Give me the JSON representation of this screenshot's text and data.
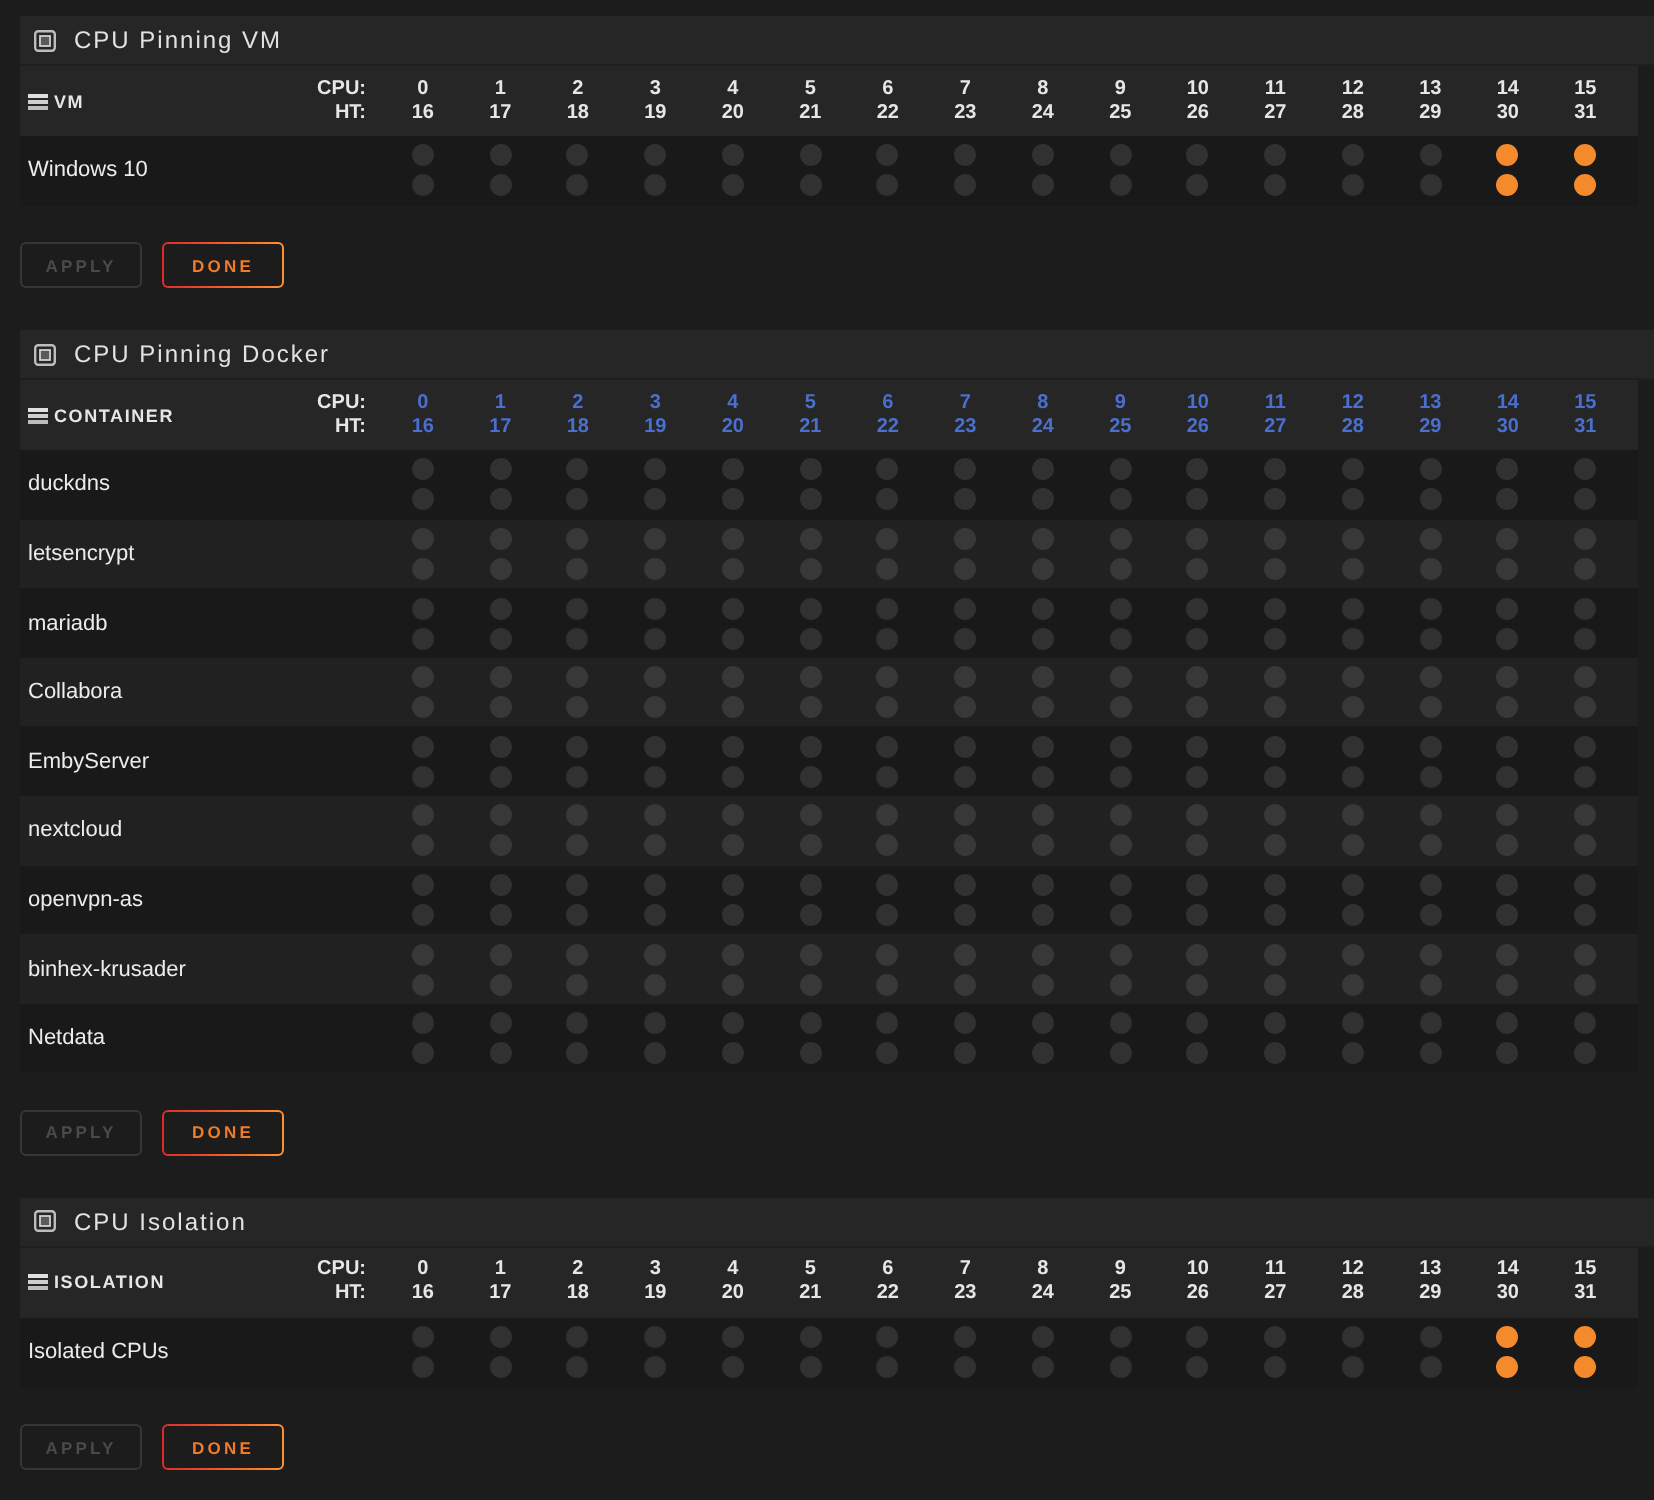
{
  "sections": [
    {
      "title": "CPU Pinning VM",
      "table": {
        "label": "VM",
        "cpu_label": "CPU:",
        "ht_label": "HT:",
        "column_links": false,
        "columns": [
          {
            "cpu": "0",
            "ht": "16"
          },
          {
            "cpu": "1",
            "ht": "17"
          },
          {
            "cpu": "2",
            "ht": "18"
          },
          {
            "cpu": "3",
            "ht": "19"
          },
          {
            "cpu": "4",
            "ht": "20"
          },
          {
            "cpu": "5",
            "ht": "21"
          },
          {
            "cpu": "6",
            "ht": "22"
          },
          {
            "cpu": "7",
            "ht": "23"
          },
          {
            "cpu": "8",
            "ht": "24"
          },
          {
            "cpu": "9",
            "ht": "25"
          },
          {
            "cpu": "10",
            "ht": "26"
          },
          {
            "cpu": "11",
            "ht": "27"
          },
          {
            "cpu": "12",
            "ht": "28"
          },
          {
            "cpu": "13",
            "ht": "29"
          },
          {
            "cpu": "14",
            "ht": "30"
          },
          {
            "cpu": "15",
            "ht": "31"
          }
        ],
        "rows": [
          {
            "name": "Windows 10",
            "cpu": [
              false,
              false,
              false,
              false,
              false,
              false,
              false,
              false,
              false,
              false,
              false,
              false,
              false,
              false,
              true,
              true
            ],
            "ht": [
              false,
              false,
              false,
              false,
              false,
              false,
              false,
              false,
              false,
              false,
              false,
              false,
              false,
              false,
              true,
              true
            ]
          }
        ]
      },
      "buttons": [
        {
          "label": "APPLY",
          "disabled": true
        },
        {
          "label": "DONE",
          "disabled": false
        }
      ]
    },
    {
      "title": "CPU Pinning Docker",
      "table": {
        "label": "CONTAINER",
        "cpu_label": "CPU:",
        "ht_label": "HT:",
        "column_links": true,
        "columns": [
          {
            "cpu": "0",
            "ht": "16"
          },
          {
            "cpu": "1",
            "ht": "17"
          },
          {
            "cpu": "2",
            "ht": "18"
          },
          {
            "cpu": "3",
            "ht": "19"
          },
          {
            "cpu": "4",
            "ht": "20"
          },
          {
            "cpu": "5",
            "ht": "21"
          },
          {
            "cpu": "6",
            "ht": "22"
          },
          {
            "cpu": "7",
            "ht": "23"
          },
          {
            "cpu": "8",
            "ht": "24"
          },
          {
            "cpu": "9",
            "ht": "25"
          },
          {
            "cpu": "10",
            "ht": "26"
          },
          {
            "cpu": "11",
            "ht": "27"
          },
          {
            "cpu": "12",
            "ht": "28"
          },
          {
            "cpu": "13",
            "ht": "29"
          },
          {
            "cpu": "14",
            "ht": "30"
          },
          {
            "cpu": "15",
            "ht": "31"
          }
        ],
        "rows": [
          {
            "name": "duckdns",
            "cpu": [
              false,
              false,
              false,
              false,
              false,
              false,
              false,
              false,
              false,
              false,
              false,
              false,
              false,
              false,
              false,
              false
            ],
            "ht": [
              false,
              false,
              false,
              false,
              false,
              false,
              false,
              false,
              false,
              false,
              false,
              false,
              false,
              false,
              false,
              false
            ]
          },
          {
            "name": "letsencrypt",
            "cpu": [
              false,
              false,
              false,
              false,
              false,
              false,
              false,
              false,
              false,
              false,
              false,
              false,
              false,
              false,
              false,
              false
            ],
            "ht": [
              false,
              false,
              false,
              false,
              false,
              false,
              false,
              false,
              false,
              false,
              false,
              false,
              false,
              false,
              false,
              false
            ]
          },
          {
            "name": "mariadb",
            "cpu": [
              false,
              false,
              false,
              false,
              false,
              false,
              false,
              false,
              false,
              false,
              false,
              false,
              false,
              false,
              false,
              false
            ],
            "ht": [
              false,
              false,
              false,
              false,
              false,
              false,
              false,
              false,
              false,
              false,
              false,
              false,
              false,
              false,
              false,
              false
            ]
          },
          {
            "name": "Collabora",
            "cpu": [
              false,
              false,
              false,
              false,
              false,
              false,
              false,
              false,
              false,
              false,
              false,
              false,
              false,
              false,
              false,
              false
            ],
            "ht": [
              false,
              false,
              false,
              false,
              false,
              false,
              false,
              false,
              false,
              false,
              false,
              false,
              false,
              false,
              false,
              false
            ]
          },
          {
            "name": "EmbyServer",
            "cpu": [
              false,
              false,
              false,
              false,
              false,
              false,
              false,
              false,
              false,
              false,
              false,
              false,
              false,
              false,
              false,
              false
            ],
            "ht": [
              false,
              false,
              false,
              false,
              false,
              false,
              false,
              false,
              false,
              false,
              false,
              false,
              false,
              false,
              false,
              false
            ]
          },
          {
            "name": "nextcloud",
            "cpu": [
              false,
              false,
              false,
              false,
              false,
              false,
              false,
              false,
              false,
              false,
              false,
              false,
              false,
              false,
              false,
              false
            ],
            "ht": [
              false,
              false,
              false,
              false,
              false,
              false,
              false,
              false,
              false,
              false,
              false,
              false,
              false,
              false,
              false,
              false
            ]
          },
          {
            "name": "openvpn-as",
            "cpu": [
              false,
              false,
              false,
              false,
              false,
              false,
              false,
              false,
              false,
              false,
              false,
              false,
              false,
              false,
              false,
              false
            ],
            "ht": [
              false,
              false,
              false,
              false,
              false,
              false,
              false,
              false,
              false,
              false,
              false,
              false,
              false,
              false,
              false,
              false
            ]
          },
          {
            "name": "binhex-krusader",
            "cpu": [
              false,
              false,
              false,
              false,
              false,
              false,
              false,
              false,
              false,
              false,
              false,
              false,
              false,
              false,
              false,
              false
            ],
            "ht": [
              false,
              false,
              false,
              false,
              false,
              false,
              false,
              false,
              false,
              false,
              false,
              false,
              false,
              false,
              false,
              false
            ]
          },
          {
            "name": "Netdata",
            "cpu": [
              false,
              false,
              false,
              false,
              false,
              false,
              false,
              false,
              false,
              false,
              false,
              false,
              false,
              false,
              false,
              false
            ],
            "ht": [
              false,
              false,
              false,
              false,
              false,
              false,
              false,
              false,
              false,
              false,
              false,
              false,
              false,
              false,
              false,
              false
            ]
          }
        ]
      },
      "buttons": [
        {
          "label": "APPLY",
          "disabled": true
        },
        {
          "label": "DONE",
          "disabled": false
        }
      ]
    },
    {
      "title": "CPU Isolation",
      "table": {
        "label": "ISOLATION",
        "cpu_label": "CPU:",
        "ht_label": "HT:",
        "column_links": false,
        "columns": [
          {
            "cpu": "0",
            "ht": "16"
          },
          {
            "cpu": "1",
            "ht": "17"
          },
          {
            "cpu": "2",
            "ht": "18"
          },
          {
            "cpu": "3",
            "ht": "19"
          },
          {
            "cpu": "4",
            "ht": "20"
          },
          {
            "cpu": "5",
            "ht": "21"
          },
          {
            "cpu": "6",
            "ht": "22"
          },
          {
            "cpu": "7",
            "ht": "23"
          },
          {
            "cpu": "8",
            "ht": "24"
          },
          {
            "cpu": "9",
            "ht": "25"
          },
          {
            "cpu": "10",
            "ht": "26"
          },
          {
            "cpu": "11",
            "ht": "27"
          },
          {
            "cpu": "12",
            "ht": "28"
          },
          {
            "cpu": "13",
            "ht": "29"
          },
          {
            "cpu": "14",
            "ht": "30"
          },
          {
            "cpu": "15",
            "ht": "31"
          }
        ],
        "rows": [
          {
            "name": "Isolated CPUs",
            "cpu": [
              false,
              false,
              false,
              false,
              false,
              false,
              false,
              false,
              false,
              false,
              false,
              false,
              false,
              false,
              true,
              true
            ],
            "ht": [
              false,
              false,
              false,
              false,
              false,
              false,
              false,
              false,
              false,
              false,
              false,
              false,
              false,
              false,
              true,
              true
            ]
          }
        ]
      },
      "buttons": [
        {
          "label": "APPLY",
          "disabled": true
        },
        {
          "label": "DONE",
          "disabled": false
        }
      ]
    }
  ]
}
